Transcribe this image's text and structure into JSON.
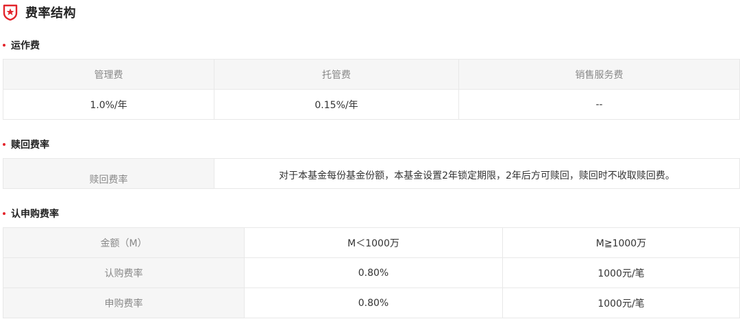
{
  "page": {
    "title": "费率结构"
  },
  "colors": {
    "accent": "#e3242b",
    "header_bg": "#f6f6f6",
    "border": "#e8e8e8"
  },
  "icons": {
    "title_icon": "shield-star-icon",
    "bullet": "red-dot-icon"
  },
  "operating_fees": {
    "title": "运作费",
    "headers": [
      "管理费",
      "托管费",
      "销售服务费"
    ],
    "values": [
      "1.0%/年",
      "0.15%/年",
      "--"
    ]
  },
  "redemption": {
    "title": "赎回费率",
    "label": "赎回费率",
    "description": "对于本基金每份基金份额，本基金设置2年锁定期限，2年后方可赎回，赎回时不收取赎回费。"
  },
  "subscription": {
    "title": "认申购费率",
    "columns": [
      "金额（M）",
      "M＜1000万",
      "M≧1000万"
    ],
    "rows": [
      {
        "label": "认购费率",
        "values": [
          "0.80%",
          "1000元/笔"
        ]
      },
      {
        "label": "申购费率",
        "values": [
          "0.80%",
          "1000元/笔"
        ]
      }
    ]
  }
}
